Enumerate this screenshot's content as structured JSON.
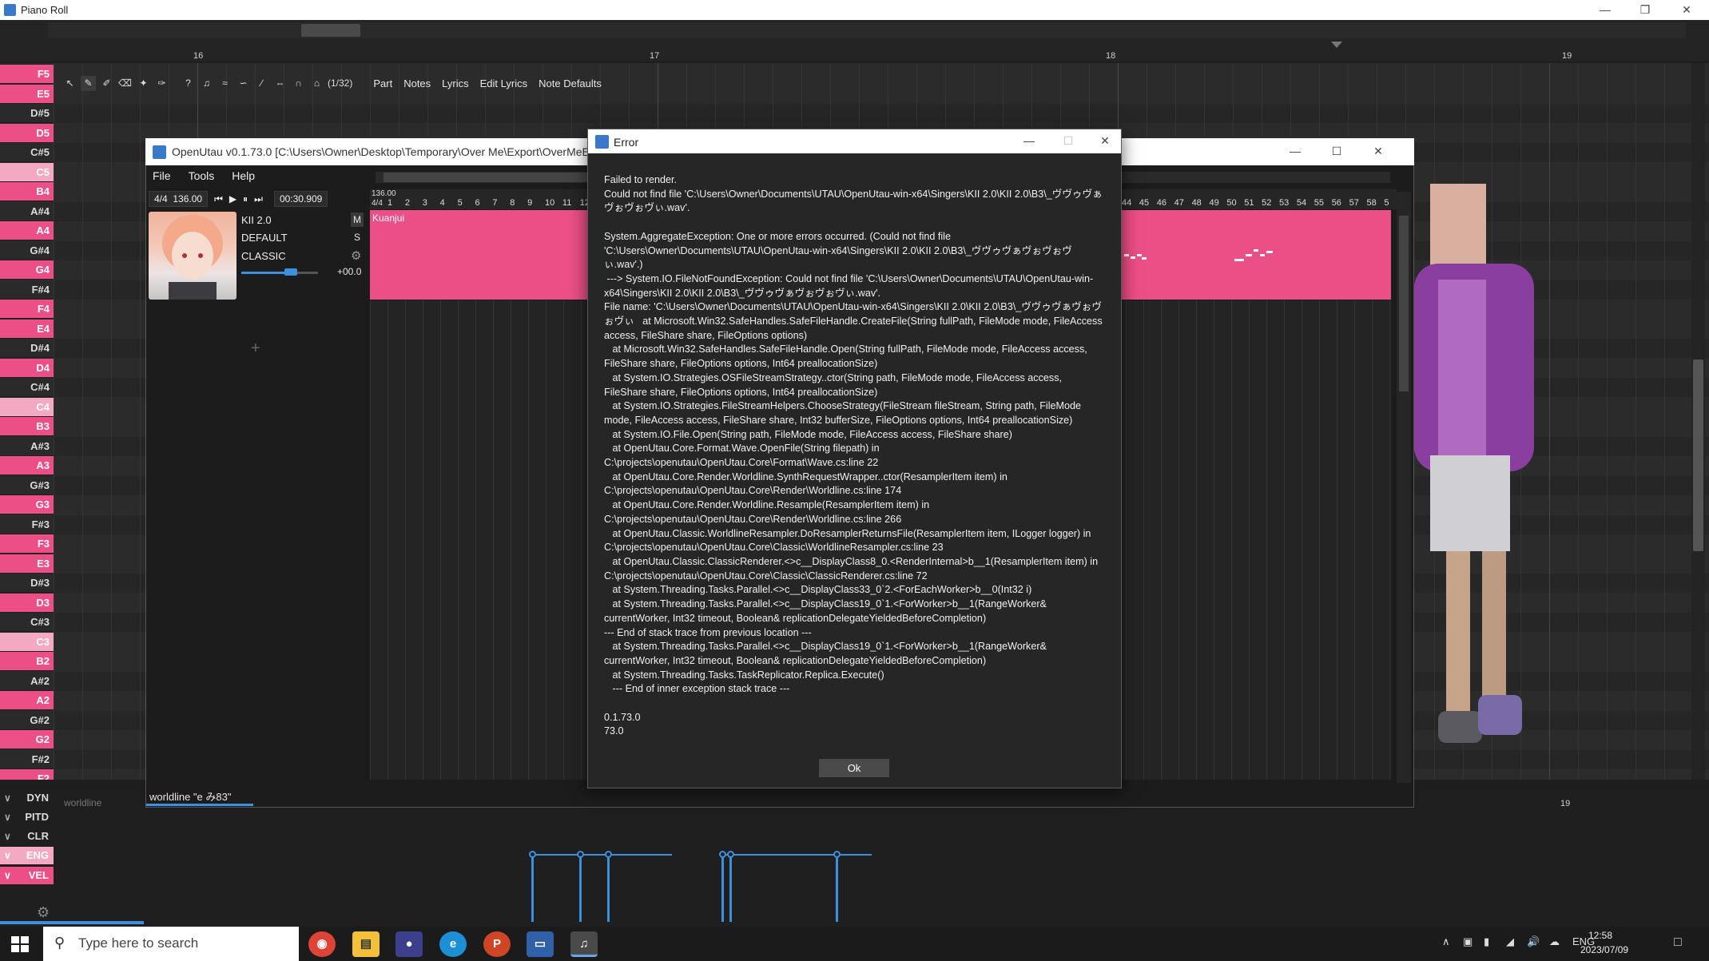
{
  "pianoroll": {
    "title": "Piano Roll",
    "bar_numbers": [
      "16",
      "17",
      "18",
      "19"
    ],
    "keys": [
      "F5",
      "E5",
      "D#5",
      "D5",
      "C#5",
      "C5",
      "B4",
      "A#4",
      "A4",
      "G#4",
      "G4",
      "F#4",
      "F4",
      "E4",
      "D#4",
      "D4",
      "C#4",
      "C4",
      "B3",
      "A#3",
      "A3",
      "G#3",
      "G3",
      "F#3",
      "F3",
      "E3",
      "D#3",
      "D3",
      "C#3",
      "C3",
      "B2",
      "A#2",
      "A2",
      "G#2",
      "G2",
      "F#2",
      "F2"
    ],
    "snap": "(1/32)",
    "toolbar_menus": [
      "Part",
      "Notes",
      "Lyrics",
      "Edit Lyrics",
      "Note Defaults"
    ],
    "expressions": [
      "DYN",
      "PITD",
      "CLR",
      "ENG",
      "VEL"
    ],
    "expr_label": "worldline",
    "expr_bar": "19"
  },
  "openutau": {
    "title": "OpenUtau v0.1.73.0 [C:\\Users\\Owner\\Desktop\\Temporary\\Over Me\\Export\\OverMeError",
    "menu": [
      "File",
      "Tools",
      "Help"
    ],
    "time_sig": "4/4",
    "bpm": "136.00",
    "time": "00:30.909",
    "track": {
      "singer": "KII 2.0",
      "phonemizer": "DEFAULT",
      "renderer": "CLASSIC",
      "mute": "M",
      "solo": "S",
      "volume": "+00.0",
      "volume_level": 0.65
    },
    "part_name": "Kuanjui",
    "timeline_bpm": "136.00",
    "timeline_sig": "4/4",
    "timeline_left": [
      "1",
      "2",
      "3",
      "4",
      "5",
      "6",
      "7",
      "8",
      "9",
      "10",
      "11",
      "12",
      "1"
    ],
    "timeline_right": [
      "44",
      "45",
      "46",
      "47",
      "48",
      "49",
      "50",
      "51",
      "52",
      "53",
      "54",
      "55",
      "56",
      "57",
      "58",
      "5"
    ],
    "status": "worldline \"e み83\""
  },
  "error_dialog": {
    "title": "Error",
    "message": "Failed to render.\nCould not find file 'C:\\Users\\Owner\\Documents\\UTAU\\OpenUtau-win-x64\\Singers\\KII 2.0\\KII 2.0\\B3\\_ヴヴゥヴぁヴぉヴぉヴぃ.wav'.\n\nSystem.AggregateException: One or more errors occurred. (Could not find file 'C:\\Users\\Owner\\Documents\\UTAU\\OpenUtau-win-x64\\Singers\\KII 2.0\\KII 2.0\\B3\\_ヴヴゥヴぁヴぉヴぉヴぃ.wav'.)\n ---> System.IO.FileNotFoundException: Could not find file 'C:\\Users\\Owner\\Documents\\UTAU\\OpenUtau-win-x64\\Singers\\KII 2.0\\KII 2.0\\B3\\_ヴヴゥヴぁヴぉヴぉヴぃ.wav'.\nFile name: 'C:\\Users\\Owner\\Documents\\UTAU\\OpenUtau-win-x64\\Singers\\KII 2.0\\KII 2.0\\B3\\_ヴヴゥヴぁヴぉヴぉヴぃ   at Microsoft.Win32.SafeHandles.SafeFileHandle.CreateFile(String fullPath, FileMode mode, FileAccess access, FileShare share, FileOptions options)\n   at Microsoft.Win32.SafeHandles.SafeFileHandle.Open(String fullPath, FileMode mode, FileAccess access, FileShare share, FileOptions options, Int64 preallocationSize)\n   at System.IO.Strategies.OSFileStreamStrategy..ctor(String path, FileMode mode, FileAccess access, FileShare share, FileOptions options, Int64 preallocationSize)\n   at System.IO.Strategies.FileStreamHelpers.ChooseStrategy(FileStream fileStream, String path, FileMode mode, FileAccess access, FileShare share, Int32 bufferSize, FileOptions options, Int64 preallocationSize)\n   at System.IO.File.Open(String path, FileMode mode, FileAccess access, FileShare share)\n   at OpenUtau.Core.Format.Wave.OpenFile(String filepath) in C:\\projects\\openutau\\OpenUtau.Core\\Format\\Wave.cs:line 22\n   at OpenUtau.Core.Render.Worldline.SynthRequestWrapper..ctor(ResamplerItem item) in C:\\projects\\openutau\\OpenUtau.Core\\Render\\Worldline.cs:line 174\n   at OpenUtau.Core.Render.Worldline.Resample(ResamplerItem item) in C:\\projects\\openutau\\OpenUtau.Core\\Render\\Worldline.cs:line 266\n   at OpenUtau.Classic.WorldlineResampler.DoResamplerReturnsFile(ResamplerItem item, ILogger logger) in C:\\projects\\openutau\\OpenUtau.Core\\Classic\\WorldlineResampler.cs:line 23\n   at OpenUtau.Classic.ClassicRenderer.<>c__DisplayClass8_0.<RenderInternal>b__1(ResamplerItem item) in C:\\projects\\openutau\\OpenUtau.Core\\Classic\\ClassicRenderer.cs:line 72\n   at System.Threading.Tasks.Parallel.<>c__DisplayClass33_0`2.<ForEachWorker>b__0(Int32 i)\n   at System.Threading.Tasks.Parallel.<>c__DisplayClass19_0`1.<ForWorker>b__1(RangeWorker& currentWorker, Int32 timeout, Boolean& replicationDelegateYieldedBeforeCompletion)\n--- End of stack trace from previous location ---\n   at System.Threading.Tasks.Parallel.<>c__DisplayClass19_0`1.<ForWorker>b__1(RangeWorker& currentWorker, Int32 timeout, Boolean& replicationDelegateYieldedBeforeCompletion)\n   at System.Threading.Tasks.TaskReplicator.Replica.Execute()\n   --- End of inner exception stack trace ---\n\n0.1.73.0\n73.0",
    "ok_label": "Ok"
  },
  "taskbar": {
    "search_placeholder": "Type here to search",
    "language": "ENG",
    "time": "12:58",
    "date": "2023/07/09"
  },
  "colors": {
    "accent_pink": "#ec4f86",
    "accent_blue": "#3d8fe0"
  }
}
